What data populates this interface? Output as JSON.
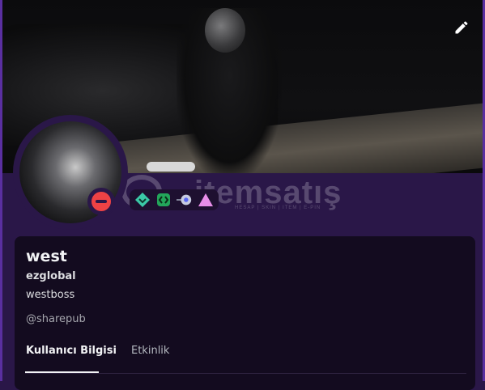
{
  "profile": {
    "display_name": "west",
    "username": "ezglobal",
    "pronouns": "westboss",
    "mention": "@sharepub",
    "status": "do-not-disturb"
  },
  "tabs": [
    {
      "label": "Kullanıcı Bilgisi",
      "active": true
    },
    {
      "label": "Etkinlik",
      "active": false
    }
  ],
  "badges": [
    "hypesquad-icon",
    "active-developer-icon",
    "nitro-boost-icon",
    "quest-triangle-icon"
  ],
  "watermark": {
    "logo_text": "itemsatış",
    "tagline": "HESAP | SKIN | ITEM | E-PIN"
  },
  "colors": {
    "background": "#2a1748",
    "card": "#130b1f",
    "accent_frame": "#5a2fa0",
    "dnd": "#ed4245"
  }
}
